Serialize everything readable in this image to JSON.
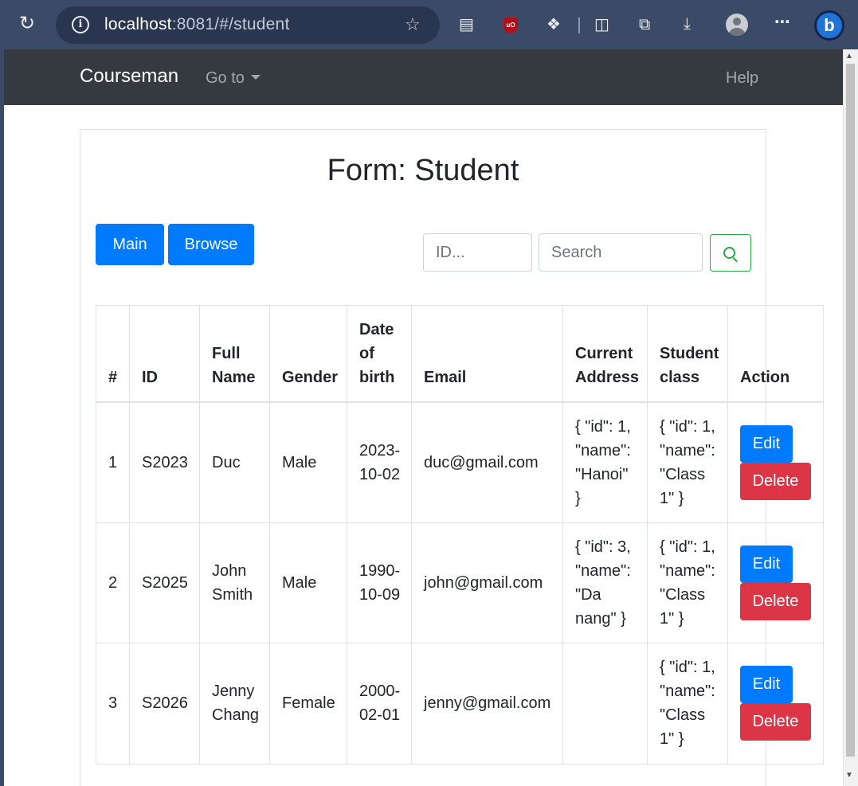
{
  "browser": {
    "url_host": "localhost",
    "url_path": ":8081/#/student"
  },
  "navbar": {
    "brand": "Courseman",
    "goto": "Go to",
    "help": "Help"
  },
  "form": {
    "title": "Form: Student",
    "main_button": "Main",
    "browse_button": "Browse",
    "id_placeholder": "ID...",
    "search_placeholder": "Search"
  },
  "table": {
    "headers": {
      "num": "#",
      "id": "ID",
      "full_name": [
        "Full",
        "Name"
      ],
      "gender": "Gender",
      "dob": [
        "Date",
        "of",
        "birth"
      ],
      "email": "Email",
      "address": [
        "Current",
        "Address"
      ],
      "class": [
        "Student",
        "class"
      ],
      "action": "Action"
    },
    "rows": [
      {
        "num": "1",
        "id": "S2023",
        "name": [
          "Duc"
        ],
        "gender": "Male",
        "dob": [
          "2023-",
          "10-02"
        ],
        "email": "duc@gmail.com",
        "address": [
          "{ \"id\": 1,",
          "\"name\":",
          "\"Hanoi\"",
          "}"
        ],
        "student_class": [
          "{ \"id\": 1,",
          "\"name\":",
          "\"Class",
          "1\" }"
        ]
      },
      {
        "num": "2",
        "id": "S2025",
        "name": [
          "John",
          "Smith"
        ],
        "gender": "Male",
        "dob": [
          "1990-",
          "10-09"
        ],
        "email": "john@gmail.com",
        "address": [
          "{ \"id\": 3,",
          "\"name\":",
          "\"Da",
          "nang\" }"
        ],
        "student_class": [
          "{ \"id\": 1,",
          "\"name\":",
          "\"Class",
          "1\" }"
        ]
      },
      {
        "num": "3",
        "id": "S2026",
        "name": [
          "Jenny",
          "Chang"
        ],
        "gender": "Female",
        "dob": [
          "2000-",
          "02-01"
        ],
        "email": "jenny@gmail.com",
        "address": [],
        "student_class": [
          "{ \"id\": 1,",
          "\"name\":",
          "\"Class",
          "1\" }"
        ]
      }
    ],
    "edit_label": "Edit",
    "delete_label": "Delete"
  },
  "colors": {
    "primary": "#007bff",
    "danger": "#dc3545",
    "success": "#28a745",
    "navbar": "#343a40",
    "browser_chrome": "#3b4a66"
  }
}
